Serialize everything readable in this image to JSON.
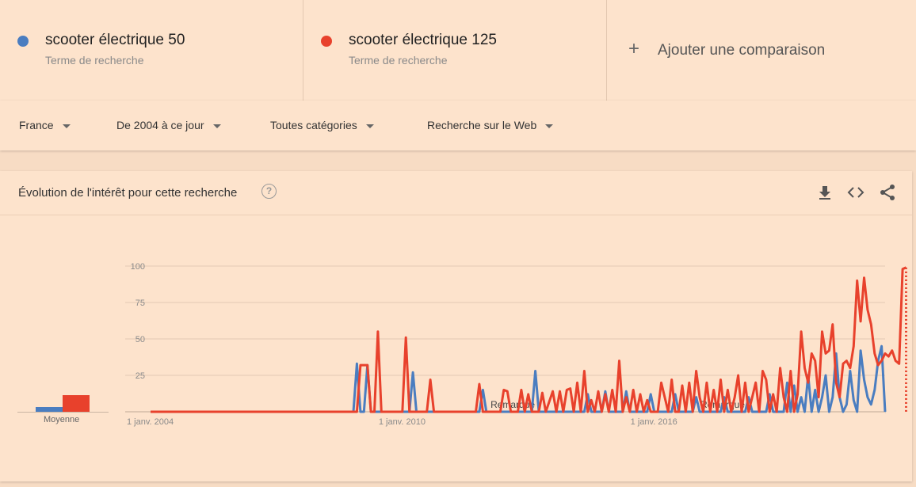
{
  "terms": [
    {
      "name": "scooter électrique 50",
      "type": "Terme de recherche",
      "color": "#4a7dc0"
    },
    {
      "name": "scooter électrique 125",
      "type": "Terme de recherche",
      "color": "#e8412c"
    }
  ],
  "add_comparison": {
    "label": "Ajouter une comparaison",
    "icon": "plus-icon"
  },
  "filters": [
    {
      "label": "France"
    },
    {
      "label": "De 2004 à ce jour"
    },
    {
      "label": "Toutes catégories"
    },
    {
      "label": "Recherche sur le Web"
    }
  ],
  "card": {
    "title": "Évolution de l'intérêt pour cette recherche",
    "help": "?",
    "tools": [
      "download-icon",
      "embed-icon",
      "share-icon"
    ]
  },
  "average": {
    "label": "Moyenne",
    "values": [
      3,
      11
    ]
  },
  "chart_data": {
    "type": "line",
    "y_ticks": [
      "100",
      "75",
      "50",
      "25"
    ],
    "ylim": [
      0,
      100
    ],
    "x_ticks": [
      "1 janv. 2004",
      "1 janv. 2010",
      "1 janv. 2016"
    ],
    "annotations": [
      "Remarque",
      "Remarque"
    ],
    "grid": true,
    "x_start": "2004-01",
    "x_end": "2021-07",
    "series": [
      {
        "name": "scooter électrique 50",
        "color": "#4a7dc0",
        "points": [
          [
            "2004-01",
            0
          ],
          [
            "2008-11",
            0
          ],
          [
            "2008-12",
            33
          ],
          [
            "2009-01",
            0
          ],
          [
            "2009-02",
            0
          ],
          [
            "2009-03",
            32
          ],
          [
            "2009-04",
            0
          ],
          [
            "2010-03",
            0
          ],
          [
            "2010-04",
            27
          ],
          [
            "2010-05",
            0
          ],
          [
            "2011-11",
            0
          ],
          [
            "2011-12",
            15
          ],
          [
            "2012-01",
            0
          ],
          [
            "2013-02",
            0
          ],
          [
            "2013-03",
            28
          ],
          [
            "2013-04",
            0
          ],
          [
            "2014-05",
            0
          ],
          [
            "2014-06",
            12
          ],
          [
            "2014-07",
            0
          ],
          [
            "2014-10",
            0
          ],
          [
            "2014-11",
            14
          ],
          [
            "2014-12",
            0
          ],
          [
            "2015-04",
            0
          ],
          [
            "2015-05",
            14
          ],
          [
            "2015-06",
            0
          ],
          [
            "2015-11",
            0
          ],
          [
            "2015-12",
            12
          ],
          [
            "2016-01",
            0
          ],
          [
            "2016-06",
            0
          ],
          [
            "2016-07",
            12
          ],
          [
            "2016-08",
            0
          ],
          [
            "2016-12",
            0
          ],
          [
            "2017-01",
            10
          ],
          [
            "2017-02",
            0
          ],
          [
            "2017-08",
            0
          ],
          [
            "2017-09",
            10
          ],
          [
            "2017-10",
            0
          ],
          [
            "2018-03",
            0
          ],
          [
            "2018-04",
            10
          ],
          [
            "2018-05",
            0
          ],
          [
            "2018-09",
            0
          ],
          [
            "2018-10",
            12
          ],
          [
            "2018-11",
            0
          ],
          [
            "2019-02",
            0
          ],
          [
            "2019-03",
            20
          ],
          [
            "2019-04",
            0
          ],
          [
            "2019-05",
            18
          ],
          [
            "2019-06",
            0
          ],
          [
            "2019-07",
            10
          ],
          [
            "2019-08",
            0
          ],
          [
            "2019-09",
            25
          ],
          [
            "2019-10",
            0
          ],
          [
            "2019-11",
            15
          ],
          [
            "2019-12",
            0
          ],
          [
            "2020-01",
            10
          ],
          [
            "2020-02",
            25
          ],
          [
            "2020-03",
            0
          ],
          [
            "2020-04",
            10
          ],
          [
            "2020-05",
            40
          ],
          [
            "2020-06",
            10
          ],
          [
            "2020-07",
            0
          ],
          [
            "2020-08",
            5
          ],
          [
            "2020-09",
            28
          ],
          [
            "2020-10",
            8
          ],
          [
            "2020-11",
            0
          ],
          [
            "2020-12",
            42
          ],
          [
            "2021-01",
            22
          ],
          [
            "2021-02",
            10
          ],
          [
            "2021-03",
            5
          ],
          [
            "2021-04",
            15
          ],
          [
            "2021-05",
            35
          ],
          [
            "2021-06",
            45
          ],
          [
            "2021-07",
            0
          ]
        ]
      },
      {
        "name": "scooter électrique 125",
        "color": "#e8412c",
        "points": [
          [
            "2004-01",
            0
          ],
          [
            "2008-11",
            0
          ],
          [
            "2008-12",
            0
          ],
          [
            "2009-01",
            32
          ],
          [
            "2009-02",
            32
          ],
          [
            "2009-03",
            32
          ],
          [
            "2009-04",
            0
          ],
          [
            "2009-05",
            0
          ],
          [
            "2009-06",
            55
          ],
          [
            "2009-07",
            0
          ],
          [
            "2010-01",
            0
          ],
          [
            "2010-02",
            51
          ],
          [
            "2010-03",
            0
          ],
          [
            "2010-08",
            0
          ],
          [
            "2010-09",
            22
          ],
          [
            "2010-10",
            0
          ],
          [
            "2011-10",
            0
          ],
          [
            "2011-11",
            19
          ],
          [
            "2011-12",
            0
          ],
          [
            "2012-05",
            0
          ],
          [
            "2012-06",
            15
          ],
          [
            "2012-07",
            14
          ],
          [
            "2012-08",
            0
          ],
          [
            "2012-10",
            0
          ],
          [
            "2012-11",
            15
          ],
          [
            "2012-12",
            0
          ],
          [
            "2013-01",
            12
          ],
          [
            "2013-02",
            0
          ],
          [
            "2013-04",
            0
          ],
          [
            "2013-05",
            13
          ],
          [
            "2013-06",
            0
          ],
          [
            "2013-08",
            14
          ],
          [
            "2013-09",
            0
          ],
          [
            "2013-10",
            14
          ],
          [
            "2013-11",
            0
          ],
          [
            "2013-12",
            15
          ],
          [
            "2014-01",
            16
          ],
          [
            "2014-02",
            0
          ],
          [
            "2014-03",
            20
          ],
          [
            "2014-04",
            0
          ],
          [
            "2014-05",
            28
          ],
          [
            "2014-06",
            0
          ],
          [
            "2014-07",
            8
          ],
          [
            "2014-08",
            0
          ],
          [
            "2014-09",
            14
          ],
          [
            "2014-10",
            0
          ],
          [
            "2014-11",
            12
          ],
          [
            "2014-12",
            0
          ],
          [
            "2015-01",
            15
          ],
          [
            "2015-02",
            0
          ],
          [
            "2015-03",
            35
          ],
          [
            "2015-04",
            0
          ],
          [
            "2015-05",
            10
          ],
          [
            "2015-06",
            0
          ],
          [
            "2015-07",
            15
          ],
          [
            "2015-08",
            0
          ],
          [
            "2015-09",
            12
          ],
          [
            "2015-10",
            0
          ],
          [
            "2015-11",
            8
          ],
          [
            "2015-12",
            0
          ],
          [
            "2016-02",
            0
          ],
          [
            "2016-03",
            20
          ],
          [
            "2016-04",
            10
          ],
          [
            "2016-05",
            0
          ],
          [
            "2016-06",
            22
          ],
          [
            "2016-07",
            0
          ],
          [
            "2016-08",
            0
          ],
          [
            "2016-09",
            18
          ],
          [
            "2016-10",
            0
          ],
          [
            "2016-11",
            20
          ],
          [
            "2016-12",
            0
          ],
          [
            "2017-01",
            28
          ],
          [
            "2017-02",
            10
          ],
          [
            "2017-03",
            0
          ],
          [
            "2017-04",
            20
          ],
          [
            "2017-05",
            0
          ],
          [
            "2017-06",
            15
          ],
          [
            "2017-07",
            0
          ],
          [
            "2017-08",
            22
          ],
          [
            "2017-09",
            0
          ],
          [
            "2017-10",
            15
          ],
          [
            "2017-11",
            0
          ],
          [
            "2017-12",
            10
          ],
          [
            "2018-01",
            25
          ],
          [
            "2018-02",
            0
          ],
          [
            "2018-03",
            20
          ],
          [
            "2018-04",
            0
          ],
          [
            "2018-05",
            10
          ],
          [
            "2018-06",
            20
          ],
          [
            "2018-07",
            0
          ],
          [
            "2018-08",
            28
          ],
          [
            "2018-09",
            22
          ],
          [
            "2018-10",
            0
          ],
          [
            "2018-11",
            12
          ],
          [
            "2018-12",
            0
          ],
          [
            "2019-01",
            30
          ],
          [
            "2019-02",
            10
          ],
          [
            "2019-03",
            0
          ],
          [
            "2019-04",
            28
          ],
          [
            "2019-05",
            0
          ],
          [
            "2019-06",
            12
          ],
          [
            "2019-07",
            55
          ],
          [
            "2019-08",
            30
          ],
          [
            "2019-09",
            20
          ],
          [
            "2019-10",
            40
          ],
          [
            "2019-11",
            35
          ],
          [
            "2019-12",
            10
          ],
          [
            "2020-01",
            55
          ],
          [
            "2020-02",
            40
          ],
          [
            "2020-03",
            42
          ],
          [
            "2020-04",
            60
          ],
          [
            "2020-05",
            20
          ],
          [
            "2020-06",
            10
          ],
          [
            "2020-07",
            33
          ],
          [
            "2020-08",
            35
          ],
          [
            "2020-09",
            30
          ],
          [
            "2020-10",
            45
          ],
          [
            "2020-11",
            90
          ],
          [
            "2020-12",
            62
          ],
          [
            "2021-01",
            92
          ],
          [
            "2021-02",
            70
          ],
          [
            "2021-03",
            60
          ],
          [
            "2021-04",
            40
          ],
          [
            "2021-05",
            32
          ],
          [
            "2021-06",
            35
          ],
          [
            "2021-07",
            40
          ],
          [
            "2021-08",
            38
          ],
          [
            "2021-09",
            42
          ],
          [
            "2021-10",
            35
          ],
          [
            "2021-11",
            33
          ],
          [
            "2021-12",
            98
          ],
          [
            "2022-01",
            99
          ]
        ]
      }
    ]
  }
}
